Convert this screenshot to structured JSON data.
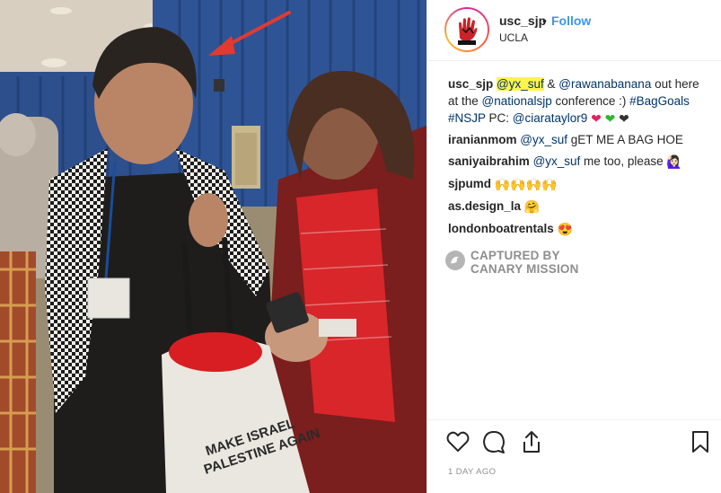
{
  "post": {
    "username": "usc_sjp",
    "separator": "•",
    "follow_label": "Follow",
    "location": "UCLA"
  },
  "caption": {
    "user": "usc_sjp",
    "mention1": "@yx_suf",
    "amp": " & ",
    "mention2": "@rawanabanana",
    "text1": " out here at the ",
    "mention3": "@nationalsjp",
    "text2": " conference :) ",
    "hashtag1": "#BagGoals",
    "hashtag2": "#NSJP",
    "text3": " PC: ",
    "mention4": "@ciarataylor9"
  },
  "hearts": [
    "❤",
    "❤",
    "❤"
  ],
  "heart_colors": [
    "#e0245e",
    "#2eb82e",
    "#333333"
  ],
  "comments": [
    {
      "user": "iranianmom",
      "mention": "@yx_suf",
      "text": " gET ME A BAG HOE"
    },
    {
      "user": "saniyaibrahim",
      "mention": "@yx_suf",
      "text": " me too, please ",
      "emoji": "🙋🏻‍♀️"
    },
    {
      "user": "sjpumd",
      "emoji": "🙌🙌🙌🙌"
    },
    {
      "user": "as.design_la",
      "emoji": "🤗"
    },
    {
      "user": "londonboatrentals",
      "emoji": "😍"
    }
  ],
  "watermark": {
    "line1": "CAPTURED BY",
    "line2": "CANARY MISSION"
  },
  "timestamp": "1 DAY AGO",
  "icons": [
    "heart-icon",
    "comment-icon",
    "share-icon",
    "bookmark-icon"
  ],
  "colors": {
    "follow_blue": "#3897f0",
    "mention_blue": "#003569",
    "highlight": "#fff34d",
    "arrow_red": "#e23a2f"
  },
  "photo": {
    "bag_text_line1": "MAKE ISRAEL",
    "bag_text_line2": "PALESTINE AGAIN"
  }
}
